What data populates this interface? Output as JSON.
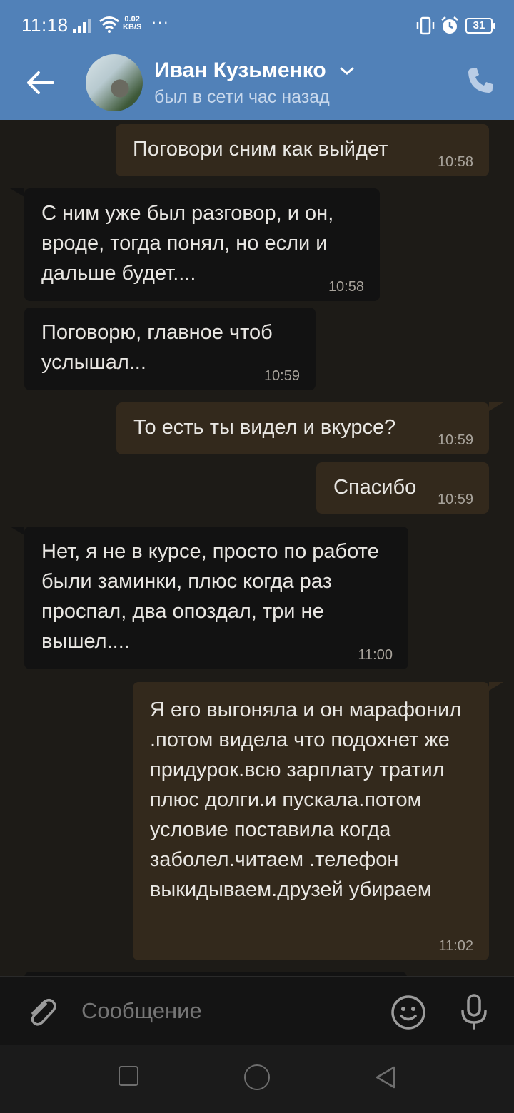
{
  "status_bar": {
    "time": "11:18",
    "net_speed_value": "0.02",
    "net_speed_unit": "KB/S",
    "more": "···",
    "battery": "31"
  },
  "header": {
    "contact_name": "Иван Кузьменко",
    "contact_status": "был в сети час назад"
  },
  "messages": [
    {
      "direction": "outgoing",
      "text": "Поговори сним как выйдет",
      "time": "10:58"
    },
    {
      "direction": "incoming",
      "text": "С ним уже был разговор, и он, вроде, тогда понял, но если и дальше будет....",
      "time": "10:58"
    },
    {
      "direction": "incoming",
      "text": "Поговорю, главное чтоб услышал...",
      "time": "10:59"
    },
    {
      "direction": "outgoing",
      "text": "То есть ты видел и вкурсе?",
      "time": "10:59"
    },
    {
      "direction": "outgoing",
      "text": "Спасибо",
      "time": "10:59"
    },
    {
      "direction": "incoming",
      "text": "Нет, я не в курсе, просто по работе были заминки, плюс когда раз  проспал, два опоздал, три не вышел....",
      "time": "11:00"
    },
    {
      "direction": "outgoing",
      "text": "Я его выгоняла и он марафонил .потом видела что подохнет же придурок.всю зарплату тратил плюс долги.и пускала.потом условие поставила когда заболел.читаем .телефон выкидываем.друзей убираем",
      "time": "11:02"
    }
  ],
  "composer": {
    "placeholder": "Сообщение"
  },
  "icons": {
    "back": "arrow-left-icon",
    "call": "phone-icon",
    "attach": "paperclip-icon",
    "emoji": "smiley-icon",
    "mic": "microphone-icon"
  },
  "colors": {
    "header_bg": "#5181b8",
    "chat_bg": "#1d1b17",
    "outgoing_bubble": "#33291c",
    "incoming_bubble": "#121212"
  }
}
